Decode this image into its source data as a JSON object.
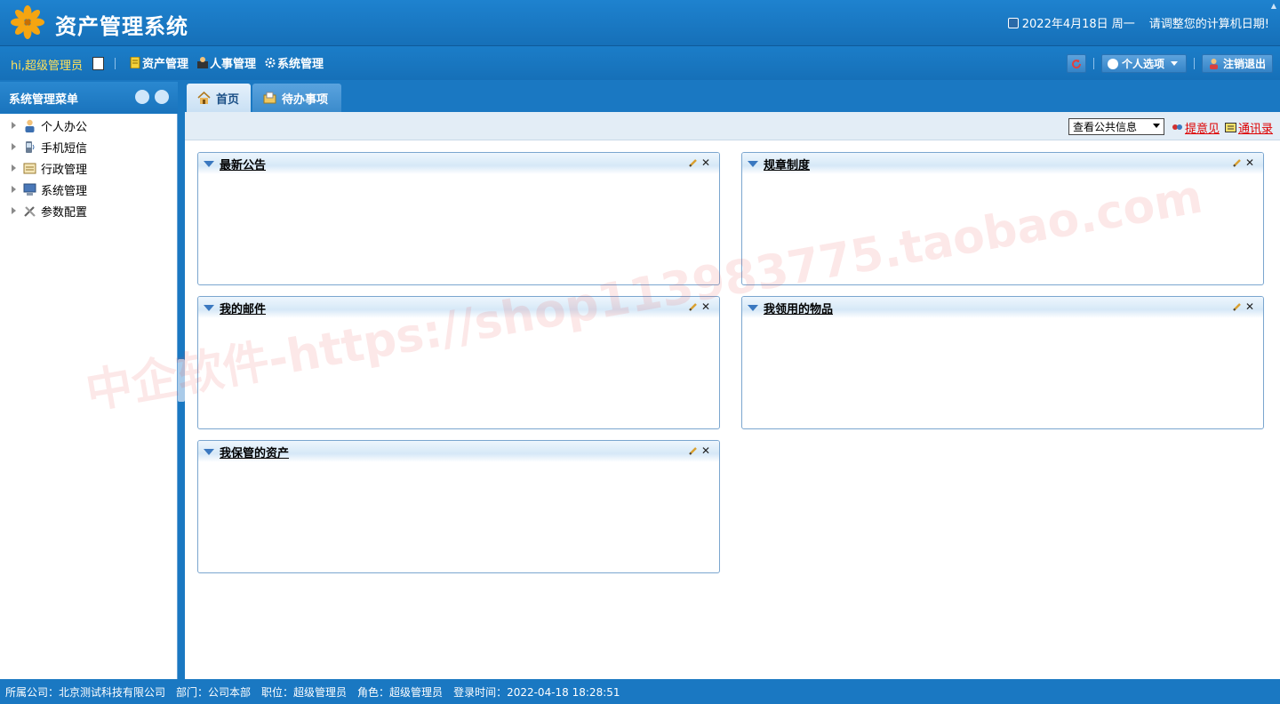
{
  "header": {
    "title": "资产管理系统",
    "date": "2022年4月18日 周一",
    "warning": "请调整您的计算机日期!"
  },
  "toolbar": {
    "greeting": "hi,超级管理员",
    "menus": [
      {
        "label": "资产管理",
        "icon": "asset-book-icon"
      },
      {
        "label": "人事管理",
        "icon": "personnel-icon"
      },
      {
        "label": "系统管理",
        "icon": "gear-icon"
      }
    ],
    "personal_options": "个人选项",
    "logout": "注销退出"
  },
  "sidebar": {
    "title": "系统管理菜单",
    "items": [
      {
        "label": "个人办公",
        "icon": "person-icon"
      },
      {
        "label": "手机短信",
        "icon": "phone-icon"
      },
      {
        "label": "行政管理",
        "icon": "admin-icon"
      },
      {
        "label": "系统管理",
        "icon": "computer-icon"
      },
      {
        "label": "参数配置",
        "icon": "tools-icon"
      }
    ]
  },
  "tabs": [
    {
      "label": "首页",
      "icon": "home-icon",
      "active": true
    },
    {
      "label": "待办事项",
      "icon": "todo-folder-icon",
      "active": false
    }
  ],
  "subbar": {
    "select_value": "查看公共信息",
    "feedback": "提意见",
    "contacts": "通讯录"
  },
  "panels": [
    {
      "title": "最新公告"
    },
    {
      "title": "规章制度"
    },
    {
      "title": "我的邮件"
    },
    {
      "title": "我领用的物品"
    },
    {
      "title": "我保管的资产"
    }
  ],
  "status": {
    "company": "所属公司：北京测试科技有限公司",
    "dept": "部门：公司本部",
    "position": "职位：超级管理员",
    "role": "角色：超级管理员",
    "login_time": "登录时间：2022-04-18 18:28:51"
  },
  "watermark": "中企软件-https://shop113983775.taobao.com",
  "colors": {
    "primary": "#1a78c2",
    "greeting": "#ffe15a",
    "link": "#dd0000"
  }
}
